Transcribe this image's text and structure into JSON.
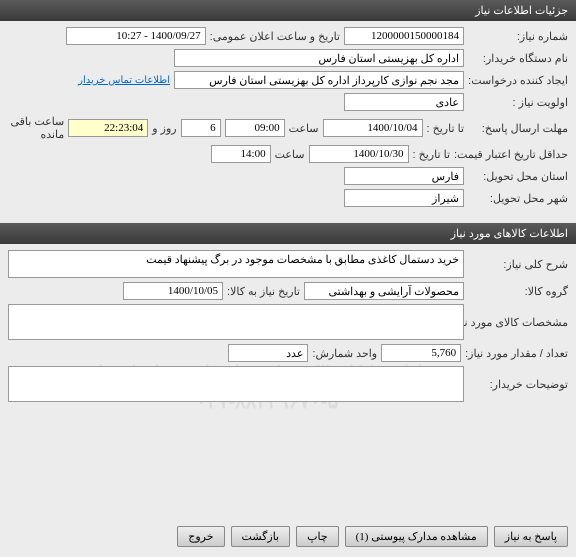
{
  "header": {
    "title": "جزئیات اطلاعات نیاز"
  },
  "form": {
    "req_no_lbl": "شماره نیاز:",
    "req_no": "1200000150000184",
    "ann_date_lbl": "تاریخ و ساعت اعلان عمومی:",
    "ann_date": "1400/09/27 - 10:27",
    "org_lbl": "نام دستگاه خریدار:",
    "org": "اداره کل بهزیستی استان فارس",
    "creator_lbl": "ایجاد کننده درخواست:",
    "creator": "مجد نجم نوازی کارپرداز اداره کل بهزیستی استان فارس",
    "contact_link": "اطلاعات تماس خریدار",
    "priority_lbl": "اولویت نیاز :",
    "priority": "عادی",
    "deadline_lbl": "مهلت ارسال پاسخ:",
    "to_date_lbl": "تا تاریخ :",
    "deadline_date": "1400/10/04",
    "time_lbl": "ساعت",
    "deadline_time": "09:00",
    "days": "6",
    "days_lbl": "روز و",
    "remain_time": "22:23:04",
    "remain_lbl": "ساعت باقی مانده",
    "min_valid_lbl": "حداقل تاریخ اعتبار قیمت:",
    "min_valid_date": "1400/10/30",
    "min_valid_time": "14:00",
    "province_lbl": "استان محل تحویل:",
    "province": "فارس",
    "city_lbl": "شهر محل تحویل:",
    "city": "شیراز"
  },
  "goods_header": "اطلاعات کالاهای مورد نیاز",
  "goods": {
    "desc_lbl": "شرح کلی نیاز:",
    "desc": "خرید دستمال کاغذی مطابق با مشخصات موجود در برگ پیشنهاد قیمت",
    "grp_lbl": "گروه کالا:",
    "grp": "محصولات آرایشی و بهداشتی",
    "need_date_lbl": "تاریخ نیاز به کالا:",
    "need_date": "1400/10/05",
    "spec_lbl": "مشخصات کالای مورد نیاز:",
    "spec": "",
    "qty_lbl": "تعداد / مقدار مورد نیاز:",
    "qty": "5,760",
    "unit_lbl": "واحد شمارش:",
    "unit": "عدد",
    "notes_lbl": "توضیحات خریدار:",
    "notes": ""
  },
  "buttons": {
    "reply": "پاسخ به نیاز",
    "attachments": "مشاهده مدارک پیوستی (1)",
    "print": "چاپ",
    "back": "بازگشت",
    "exit": "خروج"
  },
  "watermark": {
    "line1": "سامانه تدارکات الکترونیکی دولت پارس نماد داده ها",
    "line2": "۰۲۱-۸۸۳۴۹۶۷۰-۵"
  }
}
